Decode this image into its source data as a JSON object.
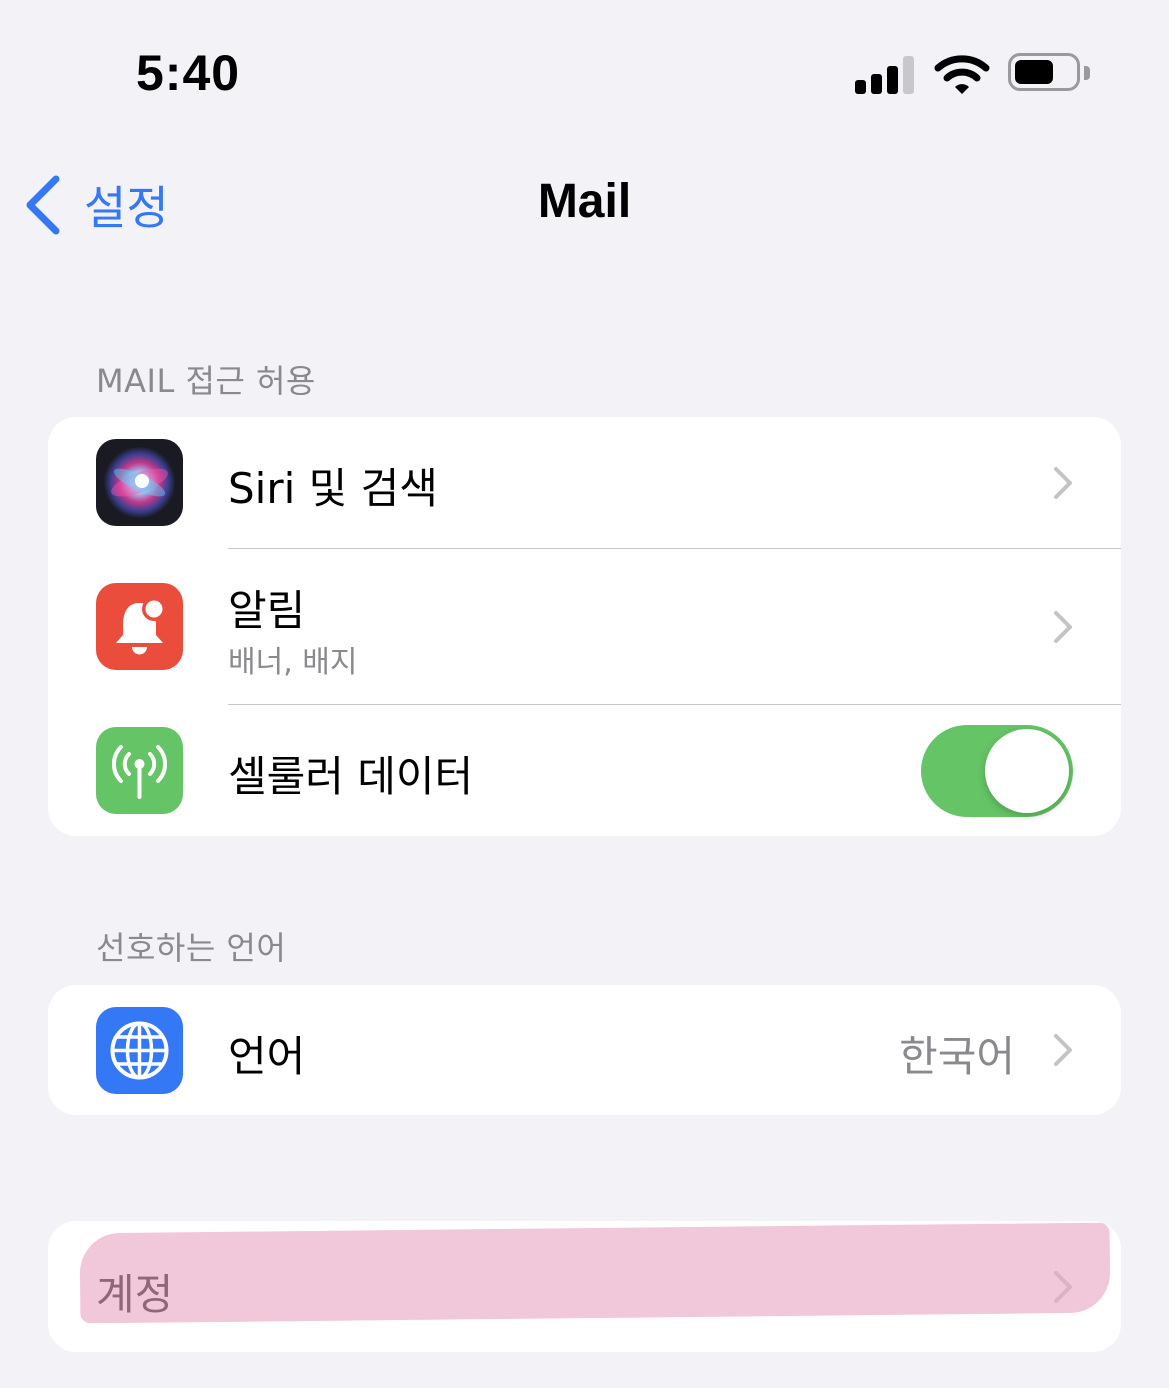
{
  "status_bar": {
    "time": "5:40"
  },
  "nav": {
    "back_label": "설정",
    "title": "Mail"
  },
  "sections": {
    "access": {
      "header": "MAIL 접근 허용",
      "siri": {
        "label": "Siri 및 검색"
      },
      "notifications": {
        "label": "알림",
        "subtitle": "배너, 배지"
      },
      "cellular": {
        "label": "셀룰러 데이터",
        "enabled": true
      }
    },
    "language": {
      "header": "선호하는 언어",
      "row": {
        "label": "언어",
        "value": "한국어"
      }
    },
    "accounts": {
      "row": {
        "label": "계정"
      }
    }
  },
  "colors": {
    "accent": "#3478f6",
    "toggle_on": "#65c466",
    "notifications_icon": "#eb4d3d",
    "cellular_icon": "#65c466",
    "language_icon": "#3478f6",
    "redaction": "#e8a5c4",
    "background": "#f2f2f7"
  },
  "icons": {
    "siri": "siri-icon",
    "notifications": "bell-icon",
    "cellular": "antenna-icon",
    "language": "globe-icon",
    "back": "chevron-left-icon",
    "disclosure": "chevron-right-icon"
  }
}
